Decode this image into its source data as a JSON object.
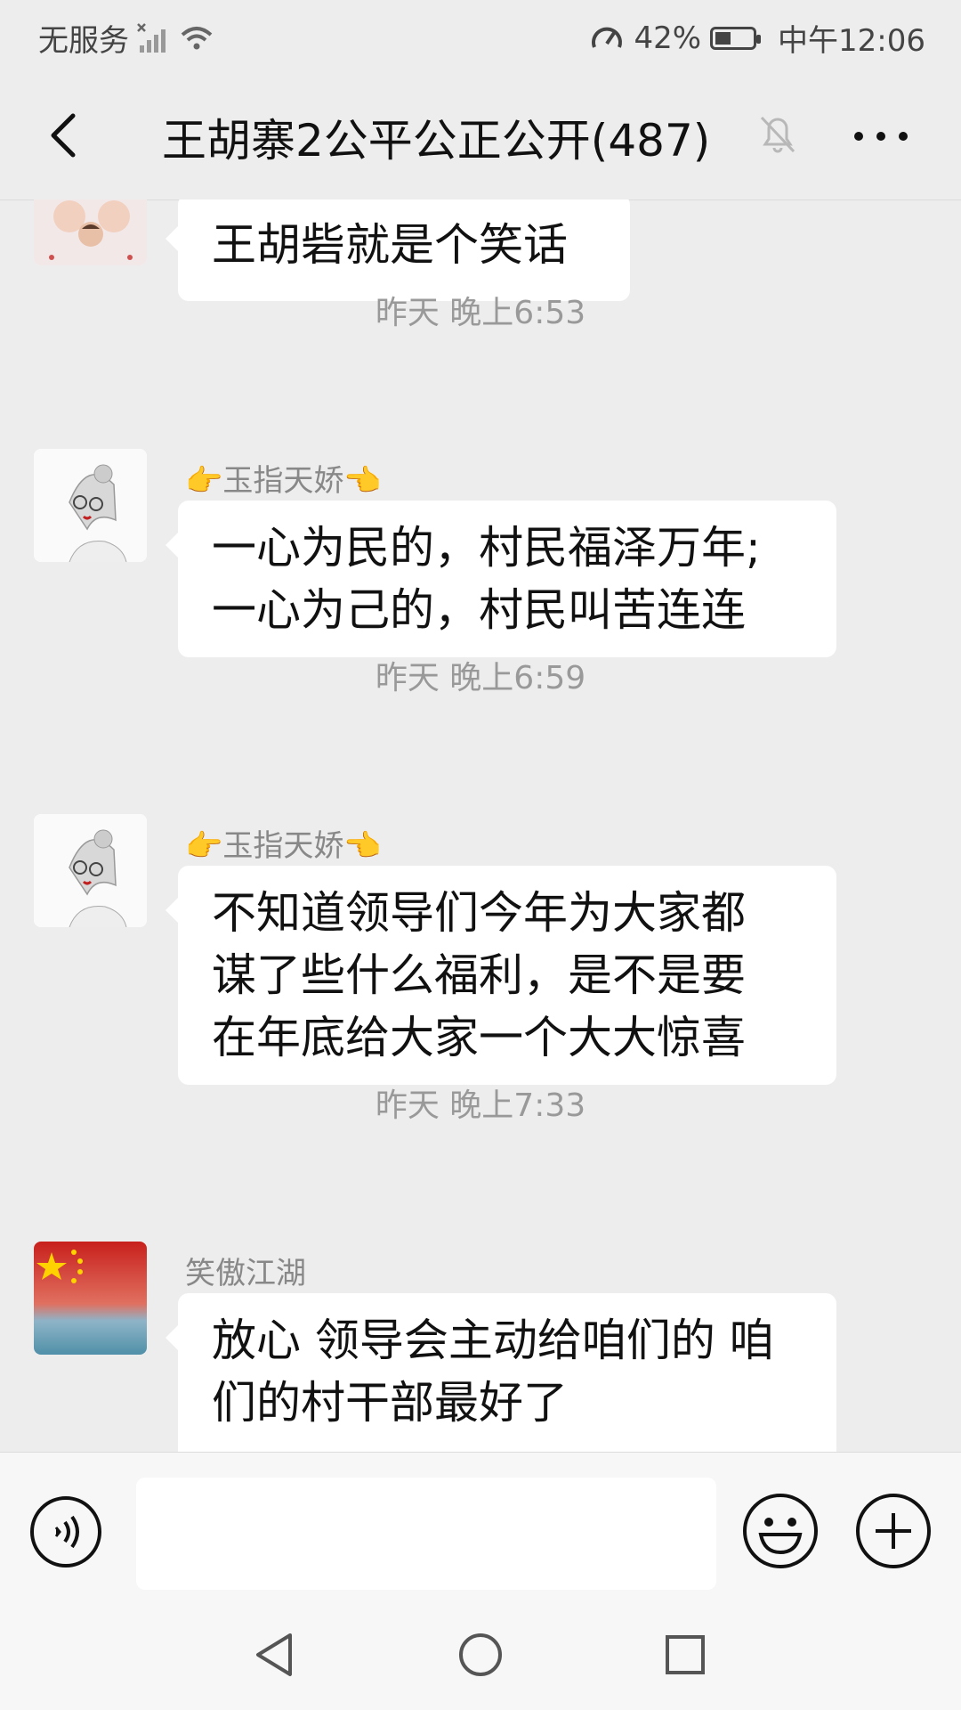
{
  "status_bar": {
    "carrier": "无服务",
    "battery": "42%",
    "battery_level": 0.42,
    "time": "中午12:06"
  },
  "header": {
    "title": "王胡寨2公平公正公开(487)"
  },
  "messages": [
    {
      "type": "message",
      "sender": "",
      "text": "王胡砦就是个笑话"
    },
    {
      "type": "time",
      "text": "昨天 晚上6:53"
    },
    {
      "type": "message",
      "sender": "👉玉指天娇👈",
      "lines": [
        "一心为民的，村民福泽万年;",
        "一心为己的，村民叫苦连连"
      ]
    },
    {
      "type": "time",
      "text": "昨天 晚上6:59"
    },
    {
      "type": "message",
      "sender": "👉玉指天娇👈",
      "lines": [
        "不知道领导们今年为大家都",
        "谋了些什么福利，是不是要",
        "在年底给大家一个大大惊喜"
      ]
    },
    {
      "type": "time",
      "text": "昨天 晚上7:33"
    },
    {
      "type": "message",
      "sender": "笑傲江湖",
      "lines": [
        "放心 领导会主动给咱们的 咱",
        "们的村干部最好了"
      ]
    }
  ],
  "colors": {
    "background": "#ededed",
    "bubble": "#ffffff",
    "text": "#111111",
    "muted": "#888888",
    "bar": "#f7f7f7"
  },
  "icons": {
    "back": "back-chevron-icon",
    "mute": "bell-off-icon",
    "more": "more-dots-icon",
    "voice": "voice-icon",
    "emoji": "smiley-icon",
    "plus": "plus-circle-icon",
    "nav_back": "triangle-back-icon",
    "nav_home": "circle-home-icon",
    "nav_recent": "square-recent-icon"
  }
}
